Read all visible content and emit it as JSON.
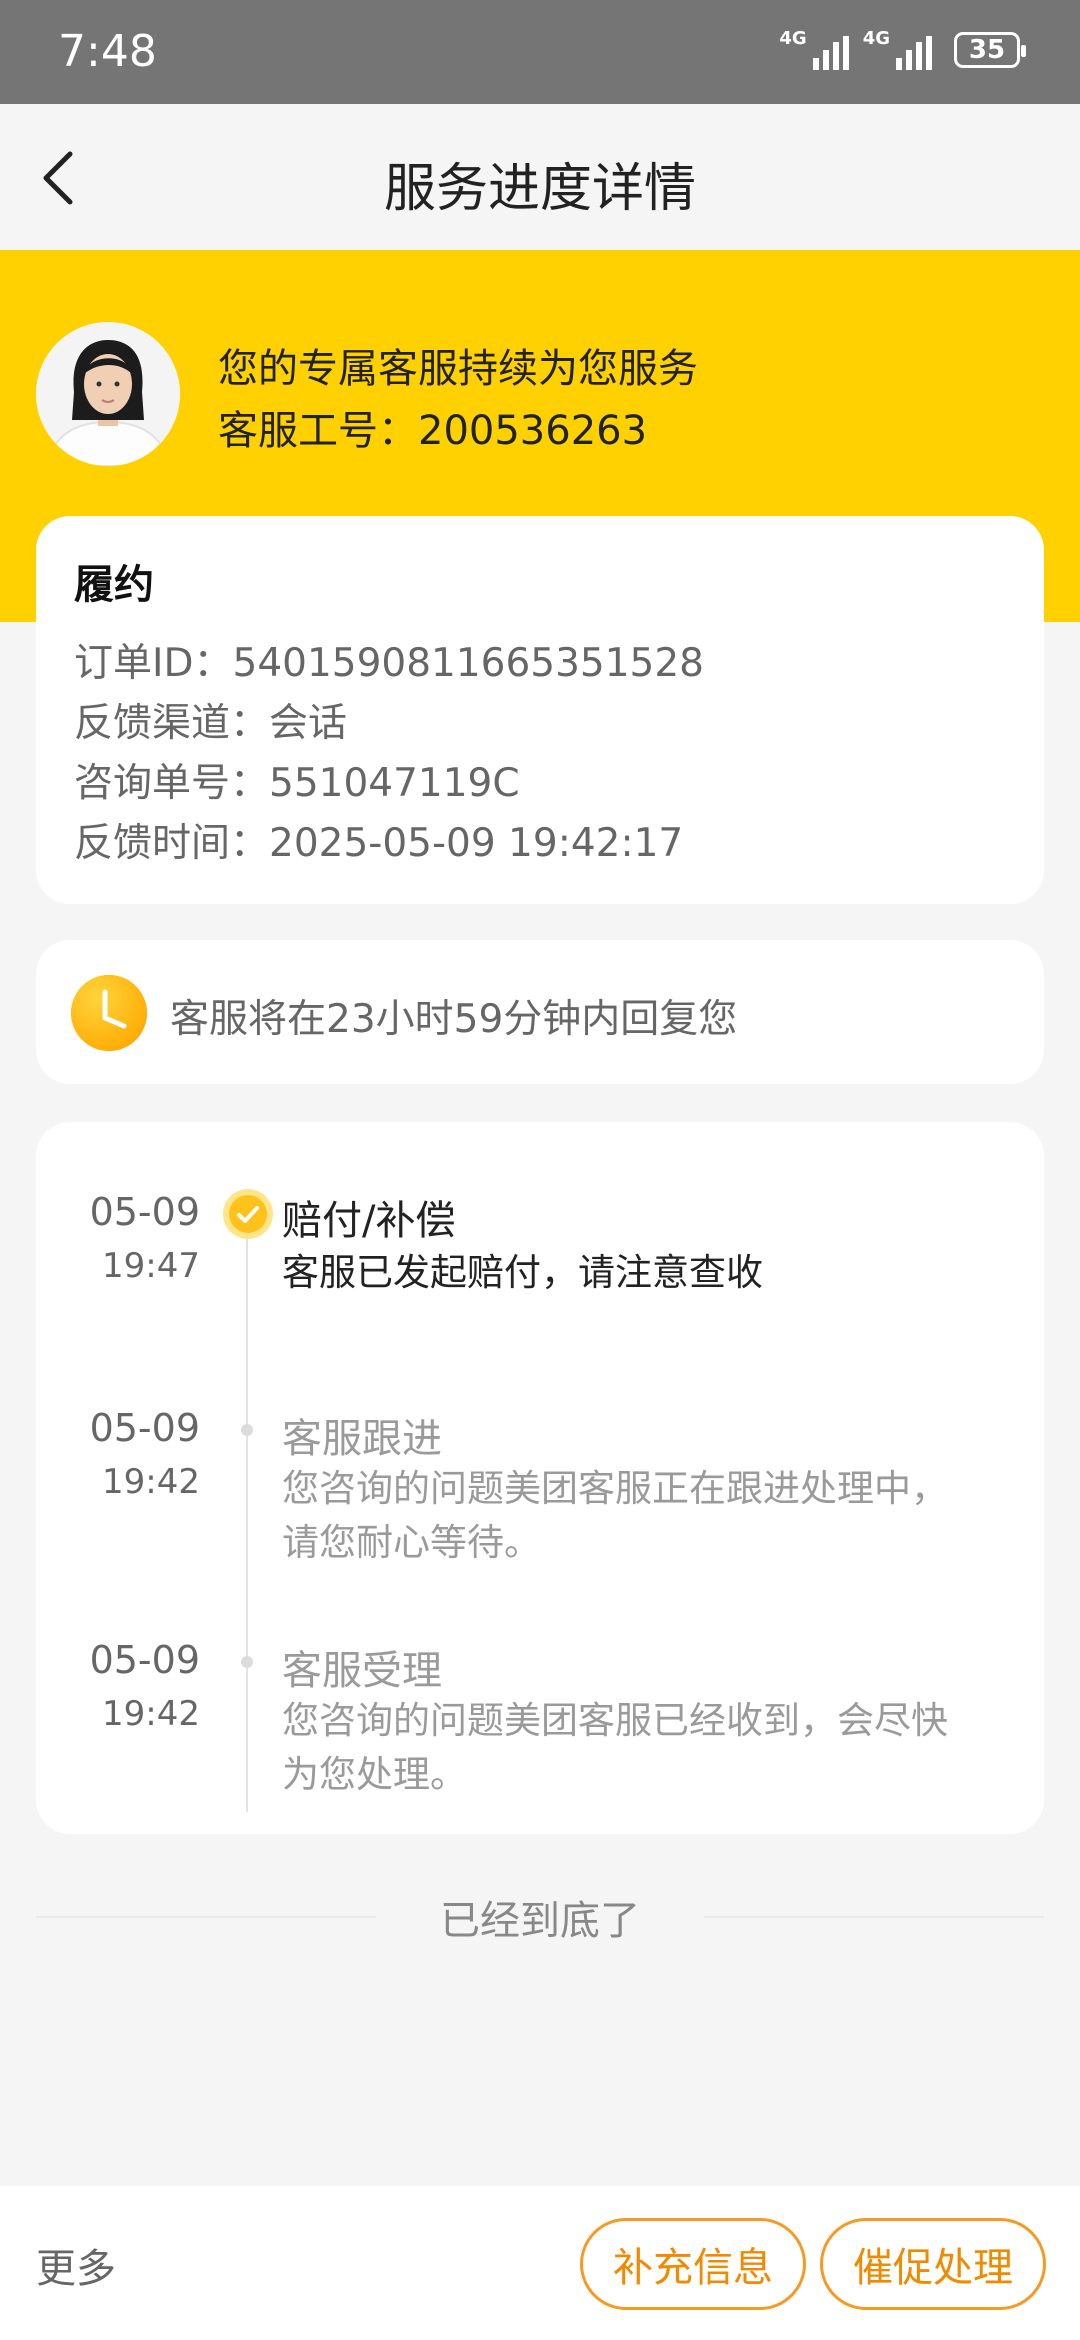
{
  "status_bar": {
    "time": "7:48",
    "network1": "4G",
    "network2": "4G",
    "battery": "35"
  },
  "nav": {
    "title": "服务进度详情"
  },
  "agent": {
    "line1": "您的专属客服持续为您服务",
    "line2": "客服工号：200536263"
  },
  "info_card": {
    "title": "履约",
    "rows": [
      {
        "label": "订单ID：",
        "value": "5401590811665351528"
      },
      {
        "label": "反馈渠道：",
        "value": "会话"
      },
      {
        "label": "咨询单号：",
        "value": "551047119C"
      },
      {
        "label": "反馈时间：",
        "value": "2025-05-09 19:42:17"
      }
    ]
  },
  "notice": {
    "text": "客服将在23小时59分钟内回复您"
  },
  "timeline": [
    {
      "date": "05-09",
      "time": "19:47",
      "title": "赔付/补偿",
      "desc": "客服已发起赔付，请注意查收",
      "active": true
    },
    {
      "date": "05-09",
      "time": "19:42",
      "title": "客服跟进",
      "desc": "您咨询的问题美团客服正在跟进处理中，请您耐心等待。",
      "active": false
    },
    {
      "date": "05-09",
      "time": "19:42",
      "title": "客服受理",
      "desc": "您咨询的问题美团客服已经收到，会尽快为您处理。",
      "active": false
    }
  ],
  "end_text": "已经到底了",
  "bottom_bar": {
    "more": "更多",
    "supplement": "补充信息",
    "urge": "催促处理"
  },
  "colors": {
    "brand_yellow": "#ffd100",
    "accent_orange": "#f08a00",
    "background": "#f5f5f5"
  }
}
